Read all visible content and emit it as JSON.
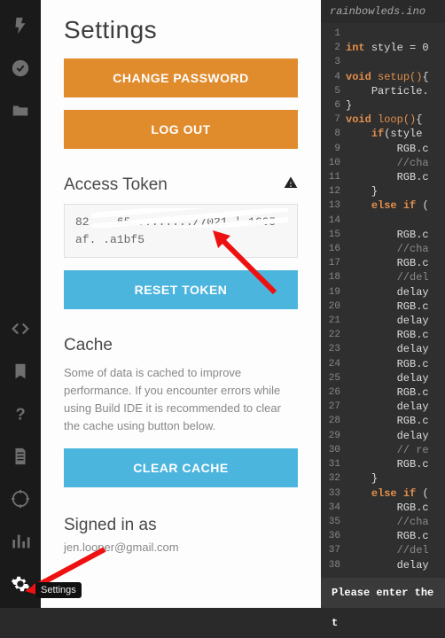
{
  "nav": {
    "tooltip": "Settings",
    "items": [
      "flash",
      "check",
      "folder",
      "code",
      "bookmark",
      "help",
      "doc",
      "target",
      "chart",
      "gear"
    ]
  },
  "settings": {
    "title": "Settings",
    "change_password": "CHANGE PASSWORD",
    "log_out": "LOG OUT",
    "access_token_label": "Access Token",
    "token_value": "82....65........./7021 ' 1605\naf. .a1bf5",
    "reset_token": "RESET TOKEN",
    "cache_label": "Cache",
    "cache_help": "Some of data is cached to improve performance. If you encounter errors while using Build IDE it is recommended to clear the cache using button below.",
    "clear_cache": "CLEAR CACHE",
    "signed_in_label": "Signed in as",
    "signed_in_email": "jen.looper@gmail.com"
  },
  "editor": {
    "filename": "rainbowleds.ino",
    "status": "Please enter the t",
    "lines": [
      {
        "n": 1,
        "html": ""
      },
      {
        "n": 2,
        "html": "<span class='kw'>int</span> <span class='tx'>style = 0</span>"
      },
      {
        "n": 3,
        "html": ""
      },
      {
        "n": 4,
        "html": "<span class='kw'>void</span> <span class='fn'>setup()</span><span class='br'>{</span>"
      },
      {
        "n": 5,
        "html": "    <span class='tx'>Particle.</span>"
      },
      {
        "n": 6,
        "html": "<span class='br'>}</span>"
      },
      {
        "n": 7,
        "html": "<span class='kw'>void</span> <span class='fn'>loop()</span><span class='br'>{</span>"
      },
      {
        "n": 8,
        "html": "    <span class='kw'>if</span><span class='tx'>(style</span>"
      },
      {
        "n": 9,
        "html": "        <span class='tx'>RGB.c</span>"
      },
      {
        "n": 10,
        "html": "        <span class='cm'>//cha</span>"
      },
      {
        "n": 11,
        "html": "        <span class='tx'>RGB.c</span>"
      },
      {
        "n": 12,
        "html": "    <span class='br'>}</span>"
      },
      {
        "n": 13,
        "html": "    <span class='kw'>else if</span> <span class='tx'>(</span>"
      },
      {
        "n": 14,
        "html": ""
      },
      {
        "n": 15,
        "html": "        <span class='tx'>RGB.c</span>"
      },
      {
        "n": 16,
        "html": "        <span class='cm'>//cha</span>"
      },
      {
        "n": 17,
        "html": "        <span class='tx'>RGB.c</span>"
      },
      {
        "n": 18,
        "html": "        <span class='cm'>//del</span>"
      },
      {
        "n": 19,
        "html": "        <span class='tx'>delay</span>"
      },
      {
        "n": 20,
        "html": "        <span class='tx'>RGB.c</span>"
      },
      {
        "n": 21,
        "html": "        <span class='tx'>delay</span>"
      },
      {
        "n": 22,
        "html": "        <span class='tx'>RGB.c</span>"
      },
      {
        "n": 23,
        "html": "        <span class='tx'>delay</span>"
      },
      {
        "n": 24,
        "html": "        <span class='tx'>RGB.c</span>"
      },
      {
        "n": 25,
        "html": "        <span class='tx'>delay</span>"
      },
      {
        "n": 26,
        "html": "        <span class='tx'>RGB.c</span>"
      },
      {
        "n": 27,
        "html": "        <span class='tx'>delay</span>"
      },
      {
        "n": 28,
        "html": "        <span class='tx'>RGB.c</span>"
      },
      {
        "n": 29,
        "html": "        <span class='tx'>delay</span>"
      },
      {
        "n": 30,
        "html": "        <span class='cm'>// re</span>"
      },
      {
        "n": 31,
        "html": "        <span class='tx'>RGB.c</span>"
      },
      {
        "n": 32,
        "html": "    <span class='br'>}</span>"
      },
      {
        "n": 33,
        "html": "    <span class='kw'>else if</span> <span class='tx'>(</span>"
      },
      {
        "n": 34,
        "html": "        <span class='tx'>RGB.c</span>"
      },
      {
        "n": 35,
        "html": "        <span class='cm'>//cha</span>"
      },
      {
        "n": 36,
        "html": "        <span class='tx'>RGB.c</span>"
      },
      {
        "n": 37,
        "html": "        <span class='cm'>//del</span>"
      },
      {
        "n": 38,
        "html": "        <span class='tx'>delay</span>"
      }
    ]
  }
}
